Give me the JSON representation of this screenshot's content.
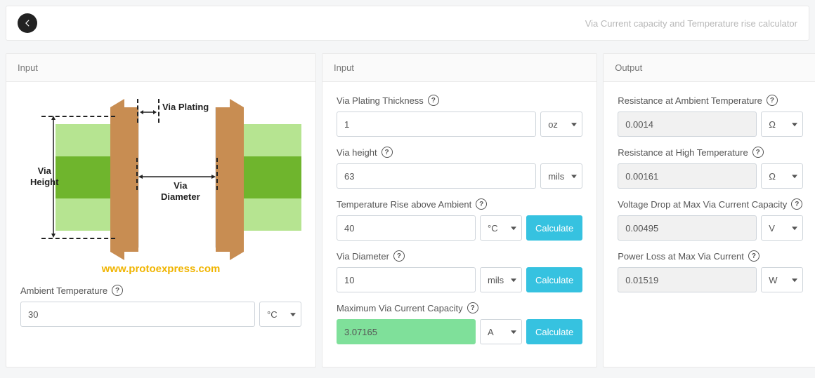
{
  "header": {
    "title": "Via Current capacity and Temperature rise calculator"
  },
  "panels": {
    "left_head": "Input",
    "mid_head": "Input",
    "right_head": "Output"
  },
  "diagram": {
    "plating_label": "Via Plating",
    "height_label_l1": "Via",
    "height_label_l2": "Height",
    "diameter_label_l1": "Via",
    "diameter_label_l2": "Diameter",
    "brand": "www.protoexpress.com"
  },
  "left": {
    "ambient_label": "Ambient Temperature",
    "ambient_value": "30",
    "ambient_unit": "°C"
  },
  "mid": {
    "plating_label": "Via Plating Thickness",
    "plating_value": "1",
    "plating_unit": "oz",
    "height_label": "Via height",
    "height_value": "63",
    "height_unit": "mils",
    "rise_label": "Temperature Rise above Ambient",
    "rise_value": "40",
    "rise_unit": "°C",
    "diameter_label": "Via Diameter",
    "diameter_value": "10",
    "diameter_unit": "mils",
    "max_label": "Maximum Via Current Capacity",
    "max_value": "3.07165",
    "max_unit": "A",
    "calc_btn": "Calculate"
  },
  "right": {
    "r_amb_label": "Resistance at Ambient Temperature",
    "r_amb_value": "0.0014",
    "r_amb_unit": "Ω",
    "r_hi_label": "Resistance at High Temperature",
    "r_hi_value": "0.00161",
    "r_hi_unit": "Ω",
    "vdrop_label": "Voltage Drop at Max Via Current Capacity",
    "vdrop_value": "0.00495",
    "vdrop_unit": "V",
    "ploss_label": "Power Loss at Max Via Current",
    "ploss_value": "0.01519",
    "ploss_unit": "W"
  }
}
